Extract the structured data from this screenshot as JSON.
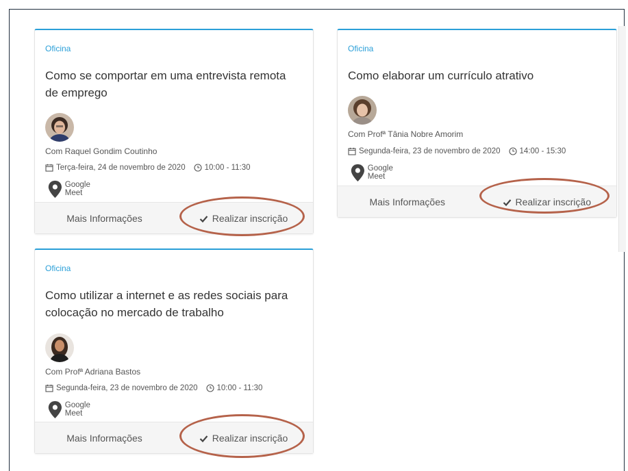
{
  "cards": [
    {
      "category": "Oficina",
      "title": "Como se comportar em uma entrevista remota de emprego",
      "instructor": "Com Raquel Gondim Coutinho",
      "date": "Terça-feira, 24 de novembro de 2020",
      "time": "10:00 - 11:30",
      "location": "Google Meet",
      "more_label": "Mais Informações",
      "enroll_label": "Realizar inscrição"
    },
    {
      "category": "Oficina",
      "title": "Como elaborar um currículo atrativo",
      "instructor": "Com Profª Tânia Nobre Amorim",
      "date": "Segunda-feira, 23 de novembro de 2020",
      "time": "14:00 - 15:30",
      "location": "Google Meet",
      "more_label": "Mais Informações",
      "enroll_label": "Realizar inscrição"
    },
    {
      "category": "Oficina",
      "title": "Como utilizar a internet e as redes sociais para colocação no mercado de trabalho",
      "instructor": "Com Profª Adriana Bastos",
      "date": "Segunda-feira, 23 de novembro de 2020",
      "time": "10:00 - 11:30",
      "location": "Google Meet",
      "more_label": "Mais Informações",
      "enroll_label": "Realizar inscrição"
    }
  ],
  "icons": {
    "calendar": "calendar-icon",
    "clock": "clock-icon",
    "location": "map-marker-icon",
    "check": "check-icon"
  },
  "colors": {
    "accent": "#2a9fd8",
    "annotation": "#b5624a",
    "footer_bg": "#f5f5f5"
  }
}
